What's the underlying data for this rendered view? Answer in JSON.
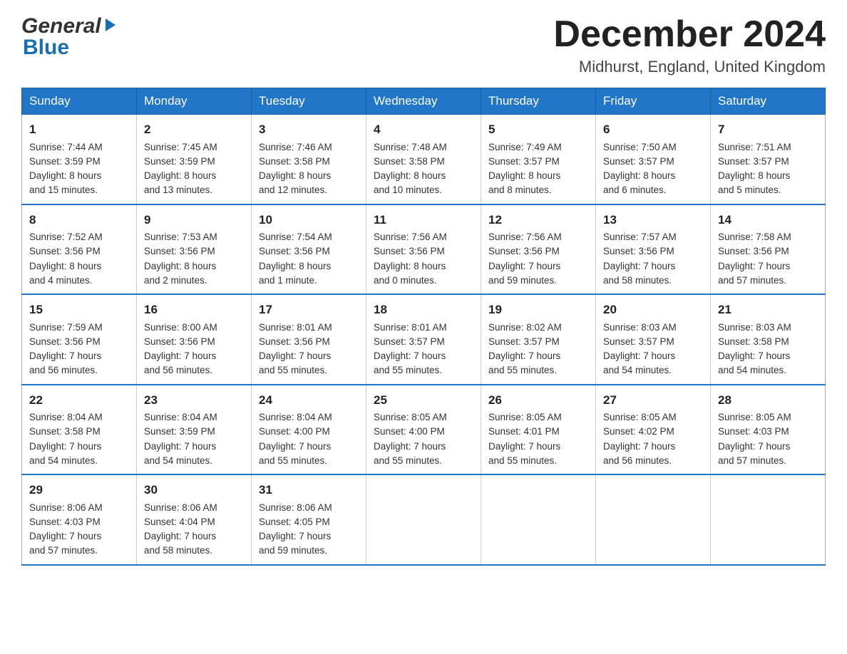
{
  "header": {
    "title": "December 2024",
    "location": "Midhurst, England, United Kingdom",
    "logo_general": "General",
    "logo_blue": "Blue"
  },
  "days_of_week": [
    "Sunday",
    "Monday",
    "Tuesday",
    "Wednesday",
    "Thursday",
    "Friday",
    "Saturday"
  ],
  "weeks": [
    [
      {
        "day": "1",
        "sunrise": "7:44 AM",
        "sunset": "3:59 PM",
        "daylight": "8 hours and 15 minutes."
      },
      {
        "day": "2",
        "sunrise": "7:45 AM",
        "sunset": "3:59 PM",
        "daylight": "8 hours and 13 minutes."
      },
      {
        "day": "3",
        "sunrise": "7:46 AM",
        "sunset": "3:58 PM",
        "daylight": "8 hours and 12 minutes."
      },
      {
        "day": "4",
        "sunrise": "7:48 AM",
        "sunset": "3:58 PM",
        "daylight": "8 hours and 10 minutes."
      },
      {
        "day": "5",
        "sunrise": "7:49 AM",
        "sunset": "3:57 PM",
        "daylight": "8 hours and 8 minutes."
      },
      {
        "day": "6",
        "sunrise": "7:50 AM",
        "sunset": "3:57 PM",
        "daylight": "8 hours and 6 minutes."
      },
      {
        "day": "7",
        "sunrise": "7:51 AM",
        "sunset": "3:57 PM",
        "daylight": "8 hours and 5 minutes."
      }
    ],
    [
      {
        "day": "8",
        "sunrise": "7:52 AM",
        "sunset": "3:56 PM",
        "daylight": "8 hours and 4 minutes."
      },
      {
        "day": "9",
        "sunrise": "7:53 AM",
        "sunset": "3:56 PM",
        "daylight": "8 hours and 2 minutes."
      },
      {
        "day": "10",
        "sunrise": "7:54 AM",
        "sunset": "3:56 PM",
        "daylight": "8 hours and 1 minute."
      },
      {
        "day": "11",
        "sunrise": "7:56 AM",
        "sunset": "3:56 PM",
        "daylight": "8 hours and 0 minutes."
      },
      {
        "day": "12",
        "sunrise": "7:56 AM",
        "sunset": "3:56 PM",
        "daylight": "7 hours and 59 minutes."
      },
      {
        "day": "13",
        "sunrise": "7:57 AM",
        "sunset": "3:56 PM",
        "daylight": "7 hours and 58 minutes."
      },
      {
        "day": "14",
        "sunrise": "7:58 AM",
        "sunset": "3:56 PM",
        "daylight": "7 hours and 57 minutes."
      }
    ],
    [
      {
        "day": "15",
        "sunrise": "7:59 AM",
        "sunset": "3:56 PM",
        "daylight": "7 hours and 56 minutes."
      },
      {
        "day": "16",
        "sunrise": "8:00 AM",
        "sunset": "3:56 PM",
        "daylight": "7 hours and 56 minutes."
      },
      {
        "day": "17",
        "sunrise": "8:01 AM",
        "sunset": "3:56 PM",
        "daylight": "7 hours and 55 minutes."
      },
      {
        "day": "18",
        "sunrise": "8:01 AM",
        "sunset": "3:57 PM",
        "daylight": "7 hours and 55 minutes."
      },
      {
        "day": "19",
        "sunrise": "8:02 AM",
        "sunset": "3:57 PM",
        "daylight": "7 hours and 55 minutes."
      },
      {
        "day": "20",
        "sunrise": "8:03 AM",
        "sunset": "3:57 PM",
        "daylight": "7 hours and 54 minutes."
      },
      {
        "day": "21",
        "sunrise": "8:03 AM",
        "sunset": "3:58 PM",
        "daylight": "7 hours and 54 minutes."
      }
    ],
    [
      {
        "day": "22",
        "sunrise": "8:04 AM",
        "sunset": "3:58 PM",
        "daylight": "7 hours and 54 minutes."
      },
      {
        "day": "23",
        "sunrise": "8:04 AM",
        "sunset": "3:59 PM",
        "daylight": "7 hours and 54 minutes."
      },
      {
        "day": "24",
        "sunrise": "8:04 AM",
        "sunset": "4:00 PM",
        "daylight": "7 hours and 55 minutes."
      },
      {
        "day": "25",
        "sunrise": "8:05 AM",
        "sunset": "4:00 PM",
        "daylight": "7 hours and 55 minutes."
      },
      {
        "day": "26",
        "sunrise": "8:05 AM",
        "sunset": "4:01 PM",
        "daylight": "7 hours and 55 minutes."
      },
      {
        "day": "27",
        "sunrise": "8:05 AM",
        "sunset": "4:02 PM",
        "daylight": "7 hours and 56 minutes."
      },
      {
        "day": "28",
        "sunrise": "8:05 AM",
        "sunset": "4:03 PM",
        "daylight": "7 hours and 57 minutes."
      }
    ],
    [
      {
        "day": "29",
        "sunrise": "8:06 AM",
        "sunset": "4:03 PM",
        "daylight": "7 hours and 57 minutes."
      },
      {
        "day": "30",
        "sunrise": "8:06 AM",
        "sunset": "4:04 PM",
        "daylight": "7 hours and 58 minutes."
      },
      {
        "day": "31",
        "sunrise": "8:06 AM",
        "sunset": "4:05 PM",
        "daylight": "7 hours and 59 minutes."
      },
      null,
      null,
      null,
      null
    ]
  ]
}
